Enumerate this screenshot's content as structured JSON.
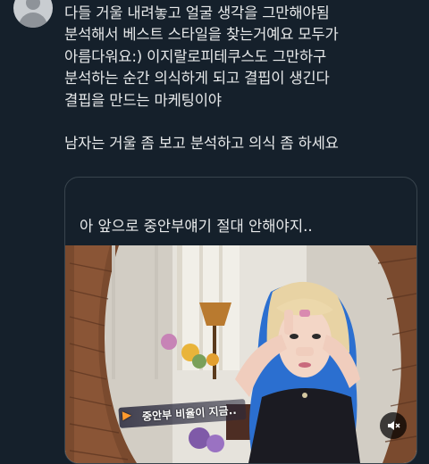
{
  "tweet": {
    "lines": [
      "다들 거울 내려놓고 얼굴 생각을 그만해야됨",
      "분석해서 베스트 스타일을 찾는거예요 모두가",
      "아름다워요:) 이지랄로피테쿠스도 그만하구",
      "분석하는 순간 의식하게 되고 결핍이 생긴다",
      "결핍을 만드는 마케팅이야",
      "남자는 거울 좀 보고 분석하고 의식 좀 하세요"
    ]
  },
  "quote": {
    "text": "아 앞으로 중안부얘기 절대 안해야지..",
    "media": {
      "caption": "중안부 비율이 지금..",
      "mute_icon": "volume-mute-icon"
    }
  },
  "colors": {
    "background": "#15202b",
    "text": "#e7e9ea",
    "border": "#38444d"
  }
}
